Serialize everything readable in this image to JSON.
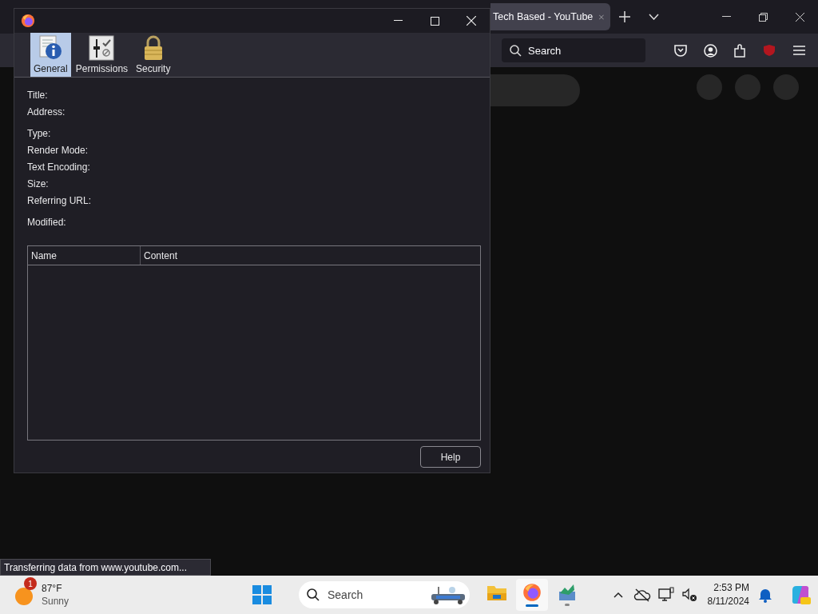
{
  "browser": {
    "tab": {
      "title": "Tech Based - YouTube"
    },
    "search": {
      "placeholder": "Search"
    }
  },
  "dialog": {
    "tabs": [
      {
        "label": "General",
        "selected": true,
        "kind": "general"
      },
      {
        "label": "Permissions",
        "selected": false,
        "kind": "permissions"
      },
      {
        "label": "Security",
        "selected": false,
        "kind": "security"
      }
    ],
    "field_groups": [
      [
        "Title:",
        "Address:"
      ],
      [
        "Type:",
        "Render Mode:",
        "Text Encoding:",
        "Size:",
        "Referring URL:"
      ],
      [
        "Modified:"
      ]
    ],
    "table": {
      "columns": [
        "Name",
        "Content"
      ]
    },
    "buttons": [
      "Help"
    ]
  },
  "status_text": "Transferring data from www.youtube.com...",
  "taskbar": {
    "weather": {
      "badge": "1",
      "temperature": "87°F",
      "condition": "Sunny"
    },
    "search": {
      "placeholder": "Search"
    },
    "apps": [
      {
        "kind": "files",
        "selected": false,
        "running": false
      },
      {
        "kind": "firefox",
        "selected": true,
        "running": true
      },
      {
        "kind": "chart",
        "selected": false,
        "running": true
      }
    ],
    "time": "2:53 PM",
    "date": "8/11/2024"
  }
}
